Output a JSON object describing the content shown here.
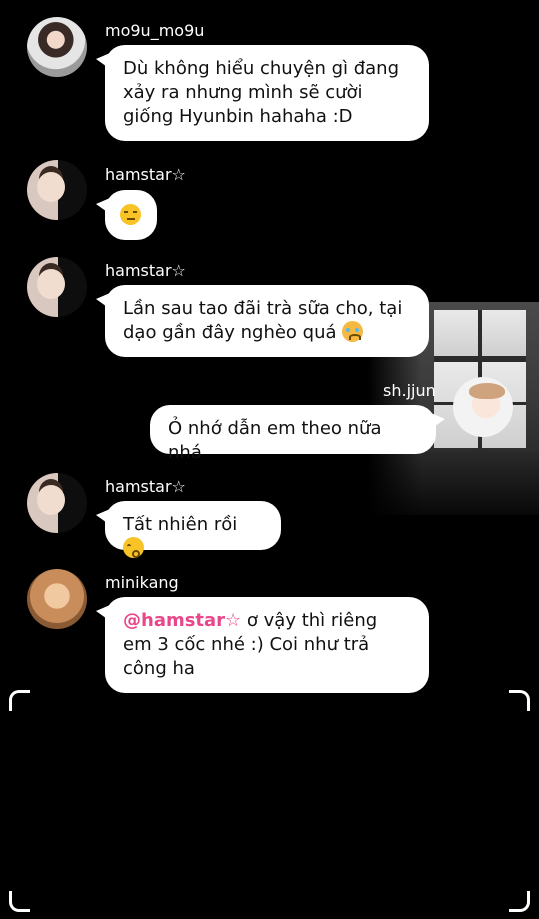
{
  "messages": [
    {
      "user": "mo9u_mo9u",
      "text": "Dù không hiểu chuyện gì đang xảy ra nhưng mình sẽ cười giống Hyunbin hahaha :D"
    },
    {
      "user": "hamstar☆",
      "emoji": "unamused-face"
    },
    {
      "user": "hamstar☆",
      "text": "Lần sau tao đãi trà sữa cho, tại dạo gần đây nghèo quá",
      "emoji": "crying-cat-face"
    },
    {
      "user": "sh.jjun",
      "text": "Ỏ nhớ dẫn em theo nữa nhá"
    },
    {
      "user": "hamstar☆",
      "text": "Tất nhiên rồi",
      "emoji": "kissing-closed-eyes-face"
    },
    {
      "user": "minikang",
      "mention": "@hamstar☆",
      "text": " ơ vậy thì riêng em 3 cốc nhé :) Coi như trả công ha"
    }
  ],
  "colors": {
    "background": "#000000",
    "bubble": "#ffffff",
    "mention": "#e8478a"
  }
}
